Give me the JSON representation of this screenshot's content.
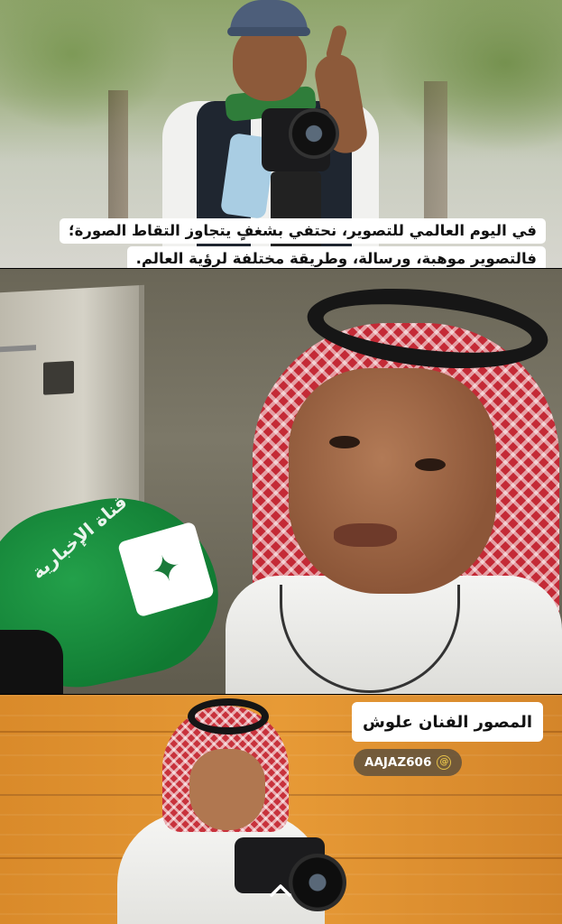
{
  "caption": {
    "line1": "في اليوم العالمي للتصوير، نحتفي بشغفٍ يتجاوز التقاط الصورة؛",
    "line2": "فالتصوير موهبة، ورسالة، وطريقة مختلفة لرؤية العالم."
  },
  "microphone": {
    "label": "قناة الإخبارية",
    "color": "#15843a"
  },
  "overlay": {
    "name_tag": "المصور الفنان علوش",
    "handle": "AAJAZ606",
    "handle_symbol": "@"
  },
  "colors": {
    "ghutra_red": "#c42a36",
    "background_orange": "#e79a36",
    "handle_pill": "#5a4e3c"
  },
  "icons": {
    "scroll_up": "chevron-up-icon"
  }
}
